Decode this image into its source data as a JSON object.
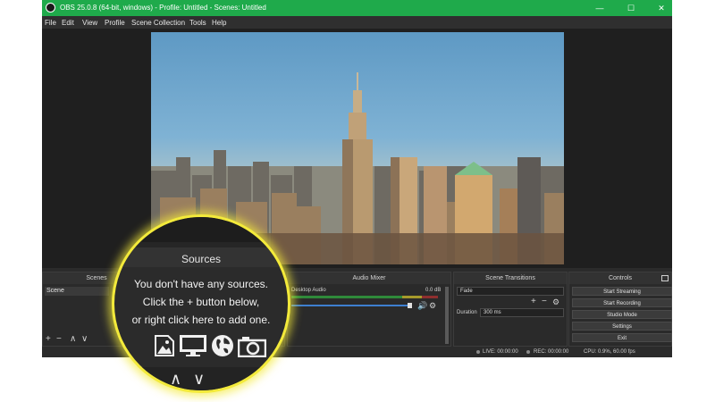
{
  "window": {
    "title": "OBS 25.0.8 (64-bit, windows) - Profile: Untitled - Scenes: Untitled",
    "controls": {
      "minimize": "—",
      "maximize": "☐",
      "close": "✕"
    }
  },
  "menu": [
    "File",
    "Edit",
    "View",
    "Profile",
    "Scene Collection",
    "Tools",
    "Help"
  ],
  "docks": {
    "scenes": {
      "title": "Scenes",
      "items": [
        "Scene"
      ]
    },
    "audio_mixer": {
      "title": "Audio Mixer",
      "source": "Desktop Audio",
      "level": "0.0 dB"
    },
    "transitions": {
      "title": "Scene Transitions",
      "type": "Fade",
      "duration_label": "Duration",
      "duration_value": "300 ms"
    },
    "controls": {
      "title": "Controls",
      "buttons": [
        "Start Streaming",
        "Start Recording",
        "Studio Mode",
        "Settings",
        "Exit"
      ]
    }
  },
  "status": {
    "live": "LIVE: 00:00:00",
    "rec": "REC: 00:00:00",
    "cpu": "CPU: 0.9%, 60.00 fps"
  },
  "magnifier": {
    "title": "Sources",
    "lines": [
      "You don't have any sources.",
      "Click the + button below,",
      "or right click here to add one."
    ],
    "icons": [
      "image-icon",
      "monitor-icon",
      "globe-icon",
      "camera-icon"
    ]
  },
  "colors": {
    "titlebar": "#1faa4b",
    "highlight_ring": "#f3ea3b"
  }
}
